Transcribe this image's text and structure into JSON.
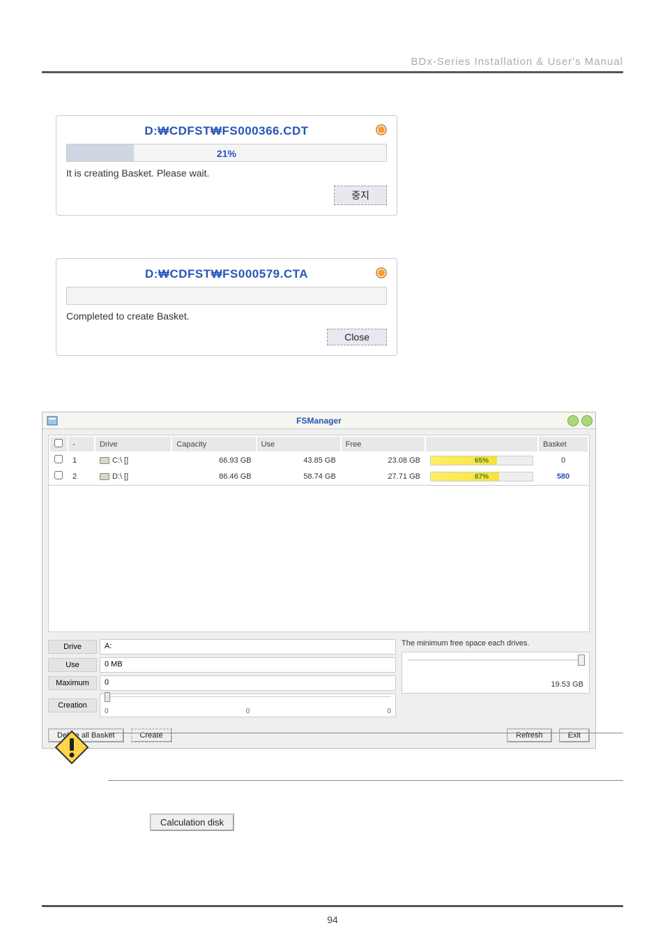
{
  "header": {
    "title": "BDx-Series Installation & User's Manual"
  },
  "dialog1": {
    "path": "D:\\CDFST\\FS000366.CDT",
    "path_display": "D:₩CDFST₩FS000366.CDT",
    "progress_pct": "21%",
    "progress_value": 21,
    "message": "It is creating Basket. Please wait.",
    "button_label": "중지"
  },
  "dialog2": {
    "path": "D:\\CDFST\\FS000579.CTA",
    "path_display": "D:₩CDFST₩FS000579.CTA",
    "progress_pct": "",
    "progress_value": 0,
    "message": "Completed to create Basket.",
    "button_label": "Close"
  },
  "fsmanager": {
    "title": "FSManager",
    "columns": {
      "chk": "-",
      "drive": "Drive",
      "capacity": "Capacity",
      "use": "Use",
      "free": "Free",
      "usage": "",
      "basket": "Basket"
    },
    "rows": [
      {
        "idx": "1",
        "drive": "C:\\ []",
        "capacity": "66.93 GB",
        "use": "43.85 GB",
        "free": "23.08 GB",
        "pct": "65%",
        "pct_num": 65,
        "basket": "0",
        "basket_blue": false
      },
      {
        "idx": "2",
        "drive": "D:\\ []",
        "capacity": "86.46 GB",
        "use": "58.74 GB",
        "free": "27.71 GB",
        "pct": "67%",
        "pct_num": 67,
        "basket": "580",
        "basket_blue": true
      }
    ],
    "form": {
      "drive_label": "Drive",
      "drive_value": "A:",
      "use_label": "Use",
      "use_value": "0 MB",
      "max_label": "Maximum",
      "max_value": "0",
      "creation_label": "Creation",
      "creation_ticks": [
        "0",
        "0",
        "0"
      ]
    },
    "min_free": {
      "label": "The minimum free space each drives.",
      "value": "19.53 GB"
    },
    "buttons": {
      "delete_all": "Delete all Basket",
      "create": "Create",
      "refresh": "Refresh",
      "exit": "Exit"
    }
  },
  "calc_button": {
    "label": "Calculation disk"
  },
  "page_number": "94"
}
